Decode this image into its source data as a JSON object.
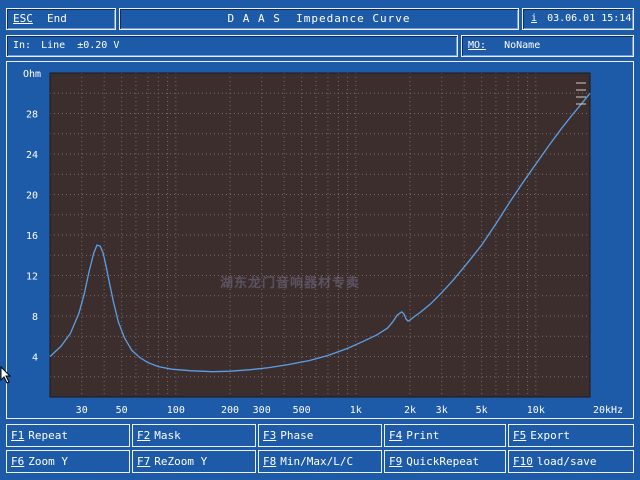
{
  "header": {
    "esc_key": "ESC",
    "end_label": "End",
    "title": "D A A S  Impedance Curve",
    "info_key": "i",
    "datetime": "03.06.01 15:14"
  },
  "infobar": {
    "input_label": "In:",
    "input_value": "Line  ±0.20 V",
    "mo_key": "MO:",
    "mo_value": "NoName"
  },
  "chart_data": {
    "type": "line",
    "title": "",
    "xlabel": "",
    "ylabel": "Ohm",
    "x_scale": "log",
    "xlim": [
      20,
      20000
    ],
    "ylim": [
      0,
      32
    ],
    "grid": true,
    "y_ticks": [
      4,
      8,
      12,
      16,
      20,
      24,
      28
    ],
    "y_tick_labels": [
      "4",
      "8",
      "12",
      "16",
      "20",
      "24",
      "28"
    ],
    "x_ticks": [
      30,
      50,
      100,
      200,
      300,
      500,
      1000,
      2000,
      3000,
      5000,
      10000,
      20000
    ],
    "x_tick_labels": [
      "30",
      "50",
      "100",
      "200",
      "300",
      "500",
      "1k",
      "2k",
      "3k",
      "5k",
      "10k",
      "20kHz"
    ],
    "colors": {
      "plot_bg": "#3d2e2e",
      "line": "#5a9fe6",
      "grid": "#7a6a6a"
    },
    "series": [
      {
        "x": [
          20,
          23,
          26,
          29,
          31,
          33,
          35,
          36.5,
          38,
          39.5,
          41,
          43,
          45,
          48,
          52,
          57,
          63,
          70,
          80,
          95,
          120,
          160,
          200,
          260,
          330,
          420,
          550,
          700,
          900,
          1100,
          1300,
          1500,
          1600,
          1700,
          1800,
          1850,
          1900,
          1950,
          2000,
          2100,
          2300,
          2600,
          3000,
          3500,
          4200,
          5000,
          6000,
          7200,
          8500,
          10000,
          12000,
          14000,
          16000,
          18000,
          20000
        ],
        "y": [
          4.0,
          5.0,
          6.3,
          8.3,
          10.2,
          12.4,
          14.2,
          15.0,
          14.9,
          14.2,
          12.9,
          11.1,
          9.4,
          7.4,
          5.8,
          4.6,
          3.9,
          3.4,
          3.0,
          2.75,
          2.6,
          2.5,
          2.55,
          2.7,
          2.9,
          3.2,
          3.6,
          4.1,
          4.8,
          5.5,
          6.1,
          6.8,
          7.4,
          8.1,
          8.4,
          8.2,
          7.7,
          7.5,
          7.6,
          7.9,
          8.4,
          9.2,
          10.3,
          11.6,
          13.3,
          15.0,
          17.1,
          19.3,
          21.2,
          23.0,
          25.0,
          26.6,
          27.9,
          29.0,
          30.0
        ]
      }
    ]
  },
  "watermark": "湖东龙门音响器材专卖",
  "function_keys": [
    {
      "key": "F1",
      "label": "Repeat"
    },
    {
      "key": "F2",
      "label": "Mask"
    },
    {
      "key": "F3",
      "label": "Phase"
    },
    {
      "key": "F4",
      "label": "Print"
    },
    {
      "key": "F5",
      "label": "Export"
    },
    {
      "key": "F6",
      "label": "Zoom Y"
    },
    {
      "key": "F7",
      "label": "ReZoom Y"
    },
    {
      "key": "F8",
      "label": "Min/Max/L/C"
    },
    {
      "key": "F9",
      "label": "QuickRepeat"
    },
    {
      "key": "F10",
      "label": "load/save"
    }
  ]
}
